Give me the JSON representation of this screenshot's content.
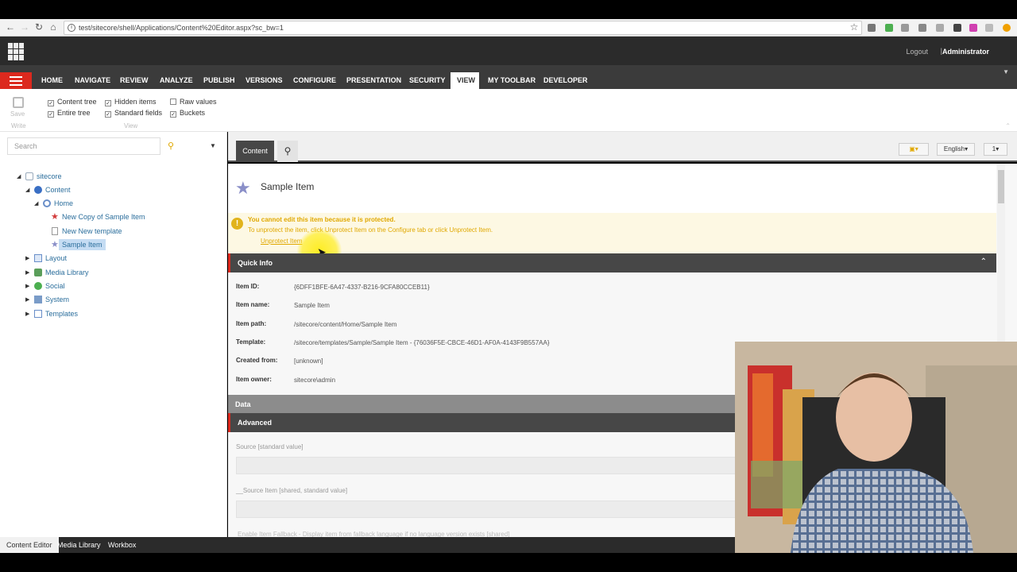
{
  "browser": {
    "url": "test/sitecore/shell/Applications/Content%20Editor.aspx?sc_bw=1"
  },
  "header": {
    "logout": "Logout",
    "separator": "|",
    "user": "Administrator"
  },
  "ribbon": {
    "tabs": [
      "HOME",
      "NAVIGATE",
      "REVIEW",
      "ANALYZE",
      "PUBLISH",
      "VERSIONS",
      "CONFIGURE",
      "PRESENTATION",
      "SECURITY",
      "VIEW",
      "MY TOOLBAR",
      "DEVELOPER"
    ],
    "active_tab": "VIEW",
    "save_label": "Save",
    "write_group": "Write",
    "view_group": "View",
    "checkboxes": [
      {
        "label": "Content tree",
        "checked": true
      },
      {
        "label": "Entire tree",
        "checked": true
      },
      {
        "label": "Hidden items",
        "checked": true
      },
      {
        "label": "Standard fields",
        "checked": true
      },
      {
        "label": "Raw values",
        "checked": false
      },
      {
        "label": "Buckets",
        "checked": true
      }
    ]
  },
  "search": {
    "placeholder": "Search"
  },
  "tree": [
    {
      "label": "sitecore",
      "icon": "sitecore-icon"
    },
    {
      "label": "Content",
      "icon": "content-icon"
    },
    {
      "label": "Home",
      "icon": "globe-icon"
    },
    {
      "label": "New Copy of Sample Item",
      "icon": "star-icon"
    },
    {
      "label": "New New template",
      "icon": "document-icon"
    },
    {
      "label": "Sample Item",
      "icon": "star-icon",
      "selected": true
    },
    {
      "label": "Layout",
      "icon": "layout-icon"
    },
    {
      "label": "Media Library",
      "icon": "media-icon"
    },
    {
      "label": "Social",
      "icon": "social-icon"
    },
    {
      "label": "System",
      "icon": "system-icon"
    },
    {
      "label": "Templates",
      "icon": "templates-icon"
    }
  ],
  "editor": {
    "content_tab": "Content",
    "language": "English",
    "version": "1",
    "item_title": "Sample Item",
    "warning_title": "You cannot edit this item because it is protected.",
    "warning_text": "To unprotect the item, click Unprotect Item on the Configure tab or click Unprotect Item.",
    "warning_link": "Unprotect Item",
    "sections": {
      "quick_info": "Quick Info",
      "data": "Data",
      "advanced": "Advanced"
    },
    "quick_info": [
      {
        "label": "Item ID:",
        "value": "{6DFF1BFE-6A47-4337-B216-9CFA80CCEB11}"
      },
      {
        "label": "Item name:",
        "value": "Sample Item"
      },
      {
        "label": "Item path:",
        "value": "/sitecore/content/Home/Sample Item"
      },
      {
        "label": "Template:",
        "value": "/sitecore/templates/Sample/Sample Item - {76036F5E-CBCE-46D1-AF0A-4143F9B557AA}"
      },
      {
        "label": "Created from:",
        "value": "[unknown]"
      },
      {
        "label": "Item owner:",
        "value": "sitecore\\admin"
      }
    ],
    "fields": [
      {
        "label": "Source [standard value]"
      },
      {
        "label": "__Source Item [shared, standard value]"
      }
    ],
    "fallback_label": "Enable Item Fallback - Display item from fallback language if no language version exists [shared]"
  },
  "bottom_tabs": [
    "Content Editor",
    "Media Library",
    "Workbox"
  ],
  "colors": {
    "accent": "#dc291e",
    "dark": "#2b2b2b",
    "warning": "#e0a800"
  }
}
